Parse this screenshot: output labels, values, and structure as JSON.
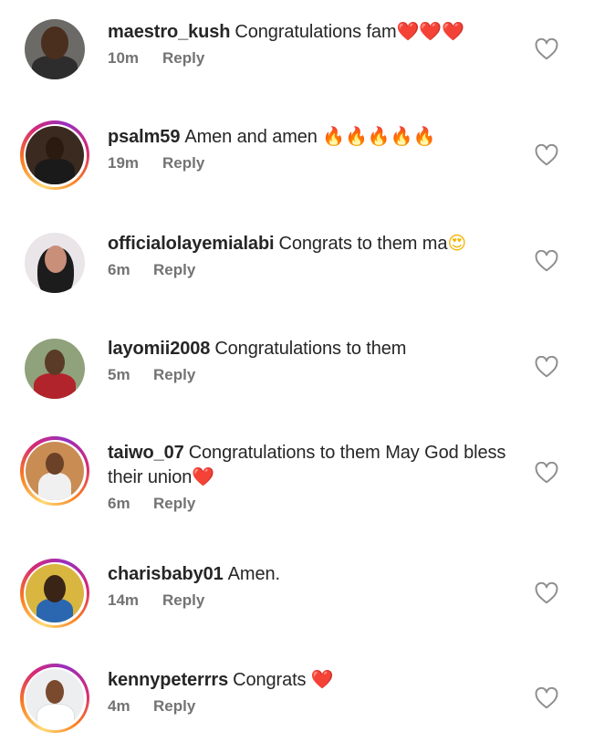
{
  "comments": [
    {
      "username": "maestro_kush",
      "text": "Congratulations fam",
      "emoji": "❤️❤️❤️",
      "time": "10m",
      "reply": "Reply",
      "story": false,
      "avatar": {
        "bg": "#6b6a66",
        "skin": "#4a2e1e",
        "cloth": "#2d2d2d"
      }
    },
    {
      "username": "psalm59",
      "text": "Amen and amen ",
      "emoji": "🔥🔥🔥🔥🔥",
      "time": "19m",
      "reply": "Reply",
      "story": true,
      "avatar": {
        "bg": "#3b2a1f",
        "skin": "#2b1a10",
        "cloth": "#1a1a1a"
      }
    },
    {
      "username": "officialolayemialabi",
      "text": "Congrats to them ma",
      "emoji": "😍",
      "time": "6m",
      "reply": "Reply",
      "story": false,
      "avatar": {
        "bg": "#e9e5e8",
        "skin": "#c98f79",
        "cloth": "#1c1c1c"
      }
    },
    {
      "username": "layomii2008",
      "text": "Congratulations to them",
      "emoji": "",
      "time": "5m",
      "reply": "Reply",
      "story": false,
      "avatar": {
        "bg": "#8fa27b",
        "skin": "#5a3b28",
        "cloth": "#b2242c"
      }
    },
    {
      "username": "taiwo_07",
      "text": "Congratulations to them May God bless their union",
      "emoji": "❤️",
      "time": "6m",
      "reply": "Reply",
      "story": true,
      "avatar": {
        "bg": "#c98c53",
        "skin": "#6b4128",
        "cloth": "#f0f0f0"
      }
    },
    {
      "username": "charisbaby01",
      "text": "Amen.",
      "emoji": "",
      "time": "14m",
      "reply": "Reply",
      "story": true,
      "avatar": {
        "bg": "#d8b640",
        "skin": "#3a2416",
        "cloth": "#2a67b0"
      }
    },
    {
      "username": "kennypeterrrs",
      "text": "Congrats ",
      "emoji": "❤️",
      "time": "4m",
      "reply": "Reply",
      "story": true,
      "avatar": {
        "bg": "#eceef0",
        "skin": "#7a4a2e",
        "cloth": "#ffffff"
      }
    }
  ],
  "colors": {
    "heart_red": "#e0245e",
    "muted": "#737373",
    "text": "#262626"
  }
}
